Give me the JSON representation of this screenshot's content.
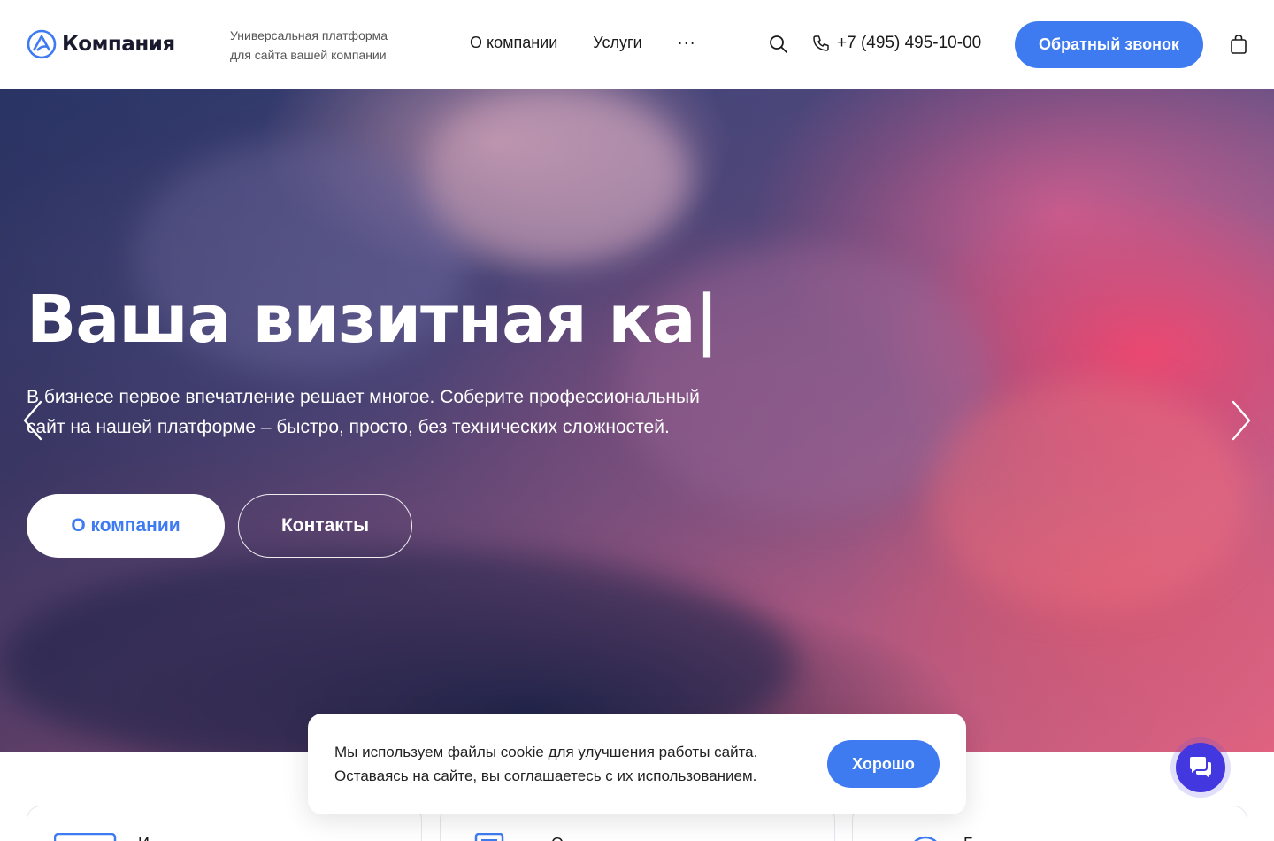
{
  "header": {
    "logo_text": "Компания",
    "tagline_line1": "Универсальная платформа",
    "tagline_line2": "для сайта вашей компании",
    "nav": [
      {
        "label": "О компании"
      },
      {
        "label": "Услуги"
      },
      {
        "label": "···"
      }
    ],
    "phone": "+7 (495) 495-10-00",
    "callback_label": "Обратный звонок"
  },
  "hero": {
    "title": "Ваша визитная ка|",
    "text_line1": "В бизнесе первое впечатление решает многое. Соберите профессиональный",
    "text_line2": "сайт на нашей платформе – быстро, просто, без технических сложностей.",
    "about_button": "О компании",
    "contacts_button": "Контакты"
  },
  "cards": [
    {
      "label": "И"
    },
    {
      "label": "О"
    },
    {
      "label": "Б"
    }
  ],
  "cookie": {
    "line1": "Мы используем файлы cookie для улучшения работы сайта.",
    "line2": "Оставаясь на сайте, вы соглашаетесь с их использованием.",
    "accept_label": "Хорошо"
  },
  "colors": {
    "accent": "#3f7bf0",
    "chat": "#4338e0"
  },
  "icons": [
    "logo-mark-icon",
    "search-icon",
    "phone-icon",
    "cart-icon",
    "arrow-left-icon",
    "arrow-right-icon",
    "chat-icon"
  ]
}
